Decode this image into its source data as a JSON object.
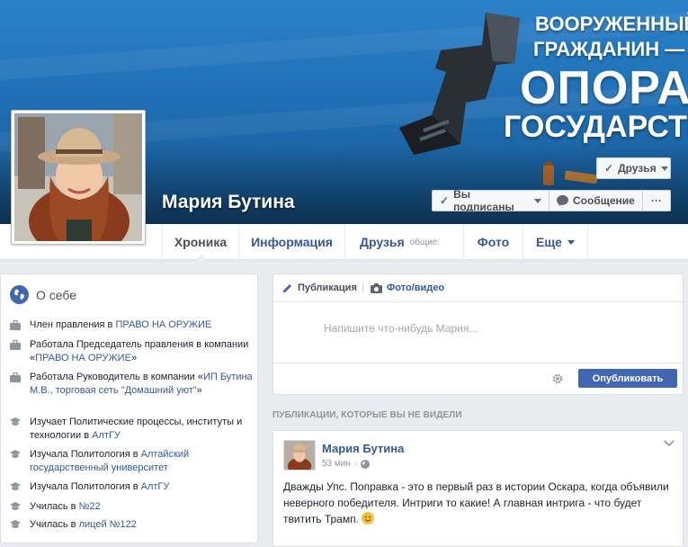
{
  "cover": {
    "slogan_line1": "ВООРУЖЕННЫЙ",
    "slogan_line2": "ГРАЖДАНИН —",
    "slogan_line3": "ОПОРА",
    "slogan_line4": "ГОСУДАРСТВА"
  },
  "profile": {
    "name": "Мария Бутина"
  },
  "actions": {
    "friends_label": "Друзья",
    "subscribed_label": "Вы подписаны",
    "message_label": "Сообщение",
    "more_label": "···"
  },
  "nav": {
    "tabs": [
      {
        "label": "Хроника"
      },
      {
        "label": "Информация"
      },
      {
        "label": "Друзья",
        "sub": "общие:"
      },
      {
        "label": "Фото"
      },
      {
        "label": "Еще"
      }
    ]
  },
  "about": {
    "title": "О себе",
    "items": [
      {
        "icon": "briefcase-icon",
        "prefix": "Член правления в ",
        "link": "ПРАВО НА ОРУЖИЕ",
        "suffix": ""
      },
      {
        "icon": "briefcase-icon",
        "prefix": "Работала Председатель правления в компании «",
        "link": "ПРАВО НА ОРУЖИЕ",
        "suffix": "»"
      },
      {
        "icon": "briefcase-icon",
        "prefix": "Работала Руководитель в компании «",
        "link": "ИП Бутина М.В., торговая сеть \"Домашний уют\"",
        "suffix": "»"
      },
      {
        "icon": "graduation-cap-icon",
        "prefix": "Изучает Политические процессы, институты и технологии в ",
        "link": "АлтГУ",
        "suffix": ""
      },
      {
        "icon": "graduation-cap-icon",
        "prefix": "Изучала Политология в ",
        "link": "Алтайский государственный университет",
        "suffix": ""
      },
      {
        "icon": "graduation-cap-icon",
        "prefix": "Изучала Политология в ",
        "link": "АлтГУ",
        "suffix": ""
      },
      {
        "icon": "graduation-cap-icon",
        "prefix": "Училась в ",
        "link": "№22",
        "suffix": ""
      },
      {
        "icon": "graduation-cap-icon",
        "prefix": "Училась в ",
        "link": "лицей №122",
        "suffix": ""
      }
    ]
  },
  "composer": {
    "tab_post": "Публикация",
    "tab_photo": "Фото/видео",
    "placeholder": "Напишите что-нибудь Мария...",
    "publish_label": "Опубликовать"
  },
  "feed": {
    "unseen_header": "ПУБЛИКАЦИИ, КОТОРЫЕ ВЫ НЕ ВИДЕЛИ"
  },
  "post": {
    "author": "Мария Бутина",
    "time": "53 мин",
    "text": "Дважды Упс. Поправка - это в первый раз в истории Оскара, когда объявили неверного победителя. Интриги то какие! А главная интрига - что будет твитить Трамп."
  },
  "colors": {
    "brand_blue": "#4267b2",
    "link_blue": "#365899",
    "cover_blue": "#1f6fb5"
  }
}
